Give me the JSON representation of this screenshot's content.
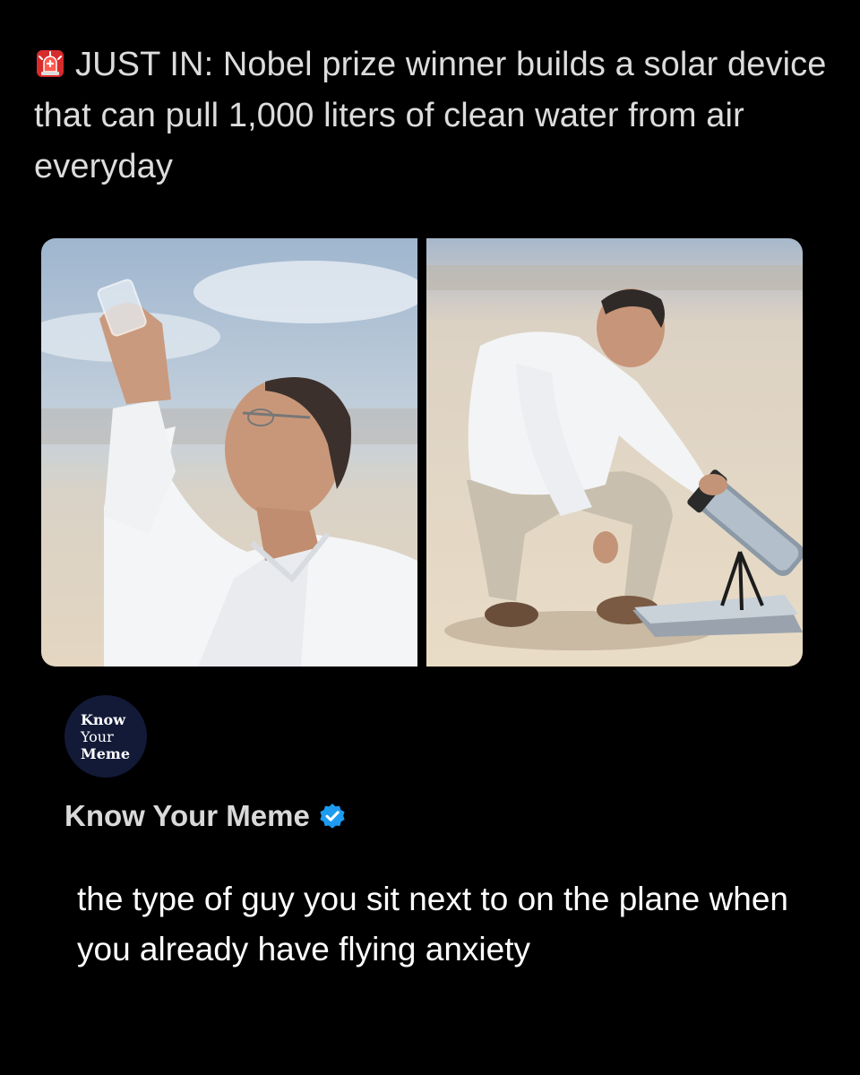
{
  "post": {
    "headline_prefix_icon": "siren-emoji-icon",
    "headline": "JUST IN: Nobel prize winner builds a solar device that can pull 1,000 liters of clean water from air everyday"
  },
  "images": {
    "left": "man-raising-glass-of-water-photo",
    "right": "man-crouching-by-solar-device-photo"
  },
  "account": {
    "logo_lines": [
      "Know",
      "Your",
      "Meme"
    ],
    "name": "Know Your Meme",
    "verified_icon": "verified-badge-icon"
  },
  "caption": "the type of guy you sit next to on the plane when you already have flying anxiety",
  "colors": {
    "background": "#000000",
    "logo_bg": "#121a37",
    "verified": "#1d9bf0"
  }
}
